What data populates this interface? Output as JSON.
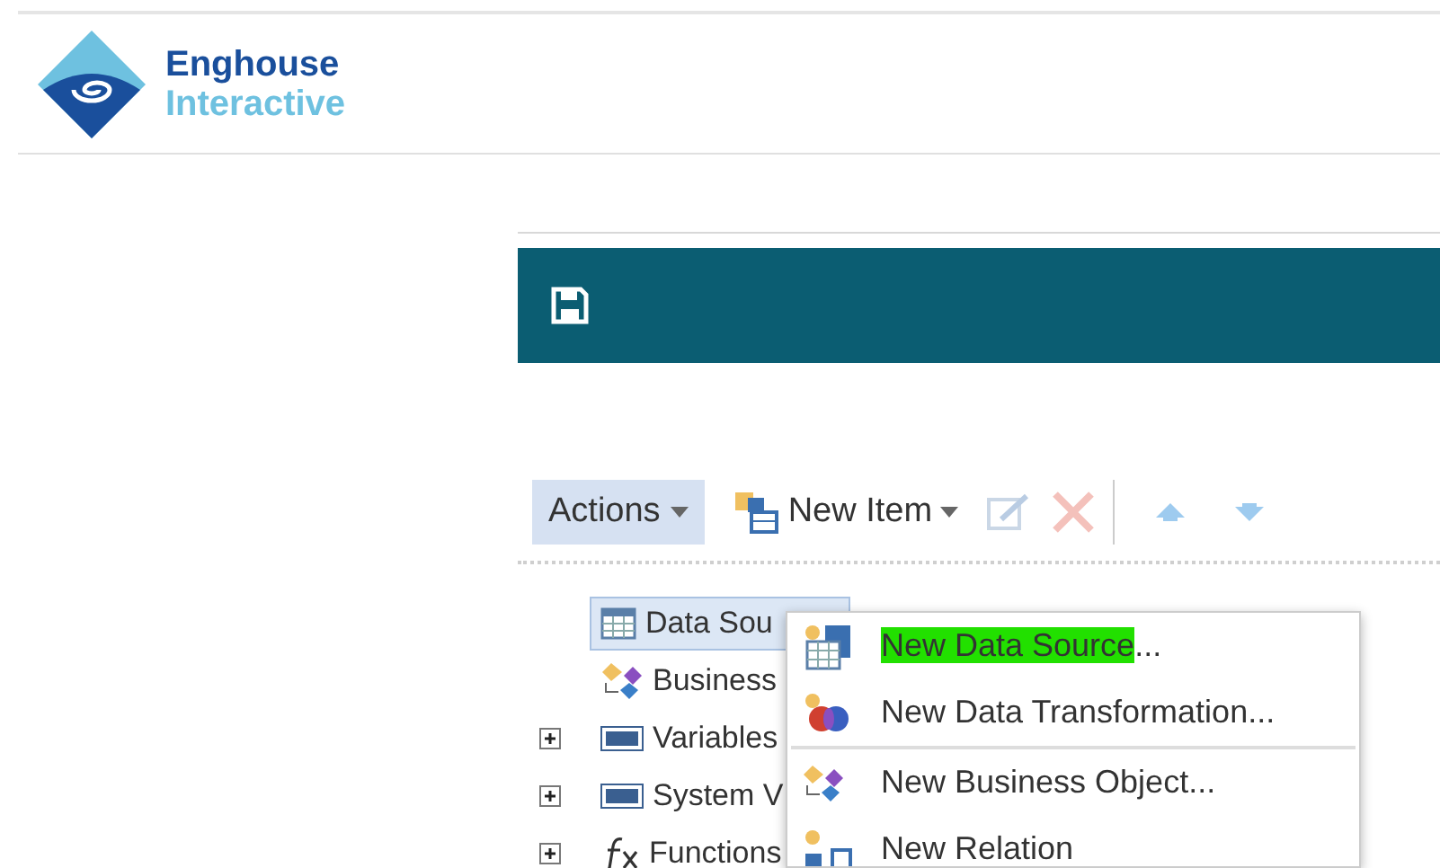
{
  "logo": {
    "line1": "Enghouse",
    "line2": "Interactive"
  },
  "toolbar": {
    "actions": "Actions",
    "new_item": "New Item",
    "edit_disabled": true,
    "delete_disabled": true
  },
  "tree": [
    {
      "label": "Data Sou",
      "kind": "table",
      "selected": true,
      "expandable": false
    },
    {
      "label": "Business",
      "kind": "business",
      "selected": false,
      "expandable": false
    },
    {
      "label": "Variables",
      "kind": "var",
      "selected": false,
      "expandable": true
    },
    {
      "label": "System V",
      "kind": "sys",
      "selected": false,
      "expandable": true
    },
    {
      "label": "Functions",
      "kind": "fx",
      "selected": false,
      "expandable": true
    }
  ],
  "menu": [
    {
      "highlighted": "New Data Source",
      "rest": "...",
      "kind": "datasource",
      "separator_after": false
    },
    {
      "rest": "New Data Transformation...",
      "kind": "transform",
      "separator_after": true
    },
    {
      "rest": "New Business Object...",
      "kind": "business",
      "separator_after": false
    },
    {
      "rest": "New Relation",
      "kind": "relation",
      "separator_after": false
    }
  ]
}
